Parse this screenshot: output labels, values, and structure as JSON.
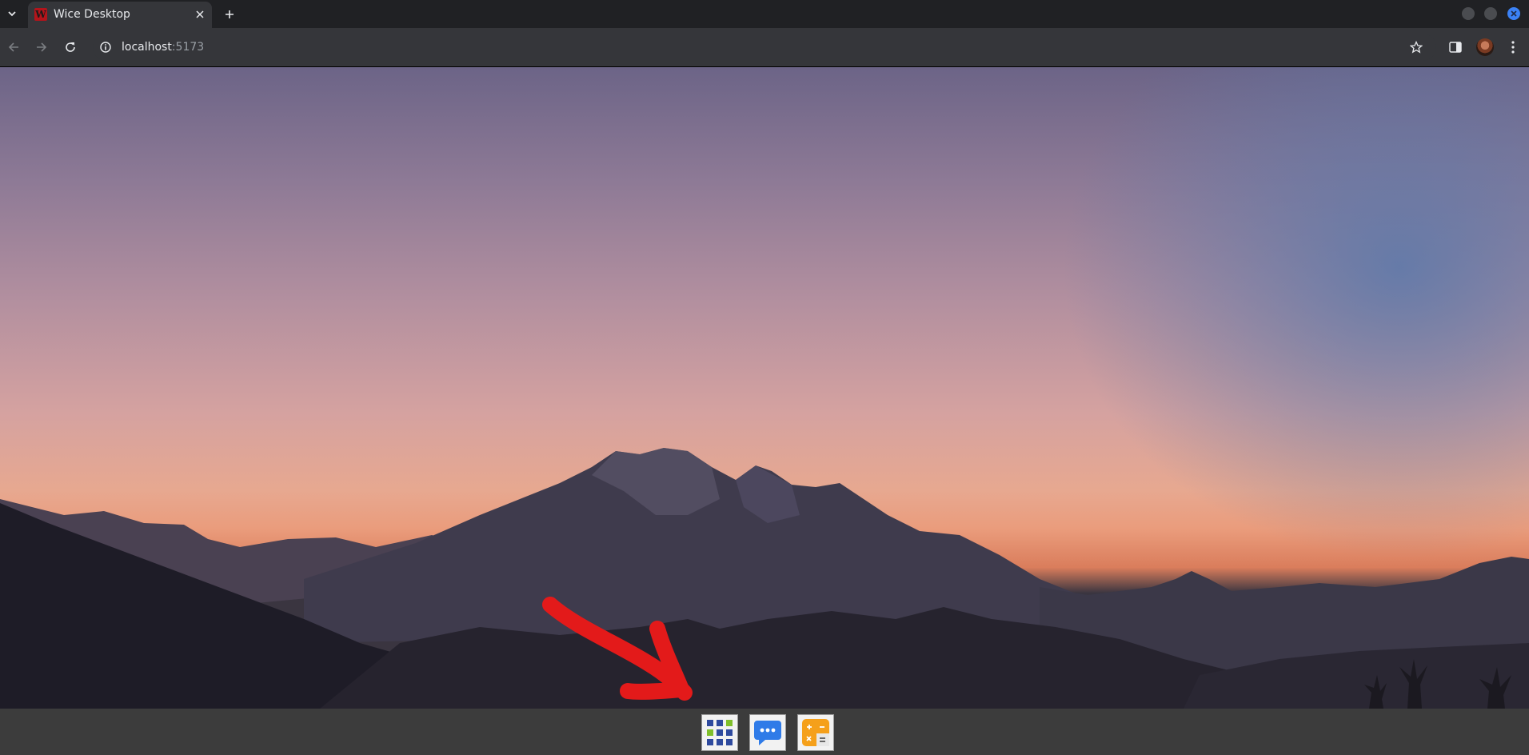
{
  "browser": {
    "tab_title": "Wice Desktop",
    "favicon_letter": "W",
    "url_host": "localhost",
    "url_port": ":5173"
  },
  "icons": {
    "tab_search": "chevron-down-icon",
    "tab_close": "close-icon",
    "new_tab": "plus-icon",
    "back": "arrow-left-icon",
    "forward": "arrow-right-icon",
    "reload": "reload-icon",
    "site_info": "info-icon",
    "bookmark": "star-icon",
    "side_panel": "side-panel-icon",
    "menu": "kebab-menu-icon"
  },
  "taskbar": {
    "apps": [
      {
        "name": "app-grid",
        "icon": "grid-apps-icon",
        "accent": "#2e4a9e"
      },
      {
        "name": "messages",
        "icon": "chat-bubble-icon",
        "accent": "#2f7be8"
      },
      {
        "name": "calculator",
        "icon": "calculator-icon",
        "accent": "#f5a01a"
      }
    ]
  },
  "colors": {
    "annotation_arrow": "#e31a1a",
    "window_close": "#3b82f6"
  }
}
